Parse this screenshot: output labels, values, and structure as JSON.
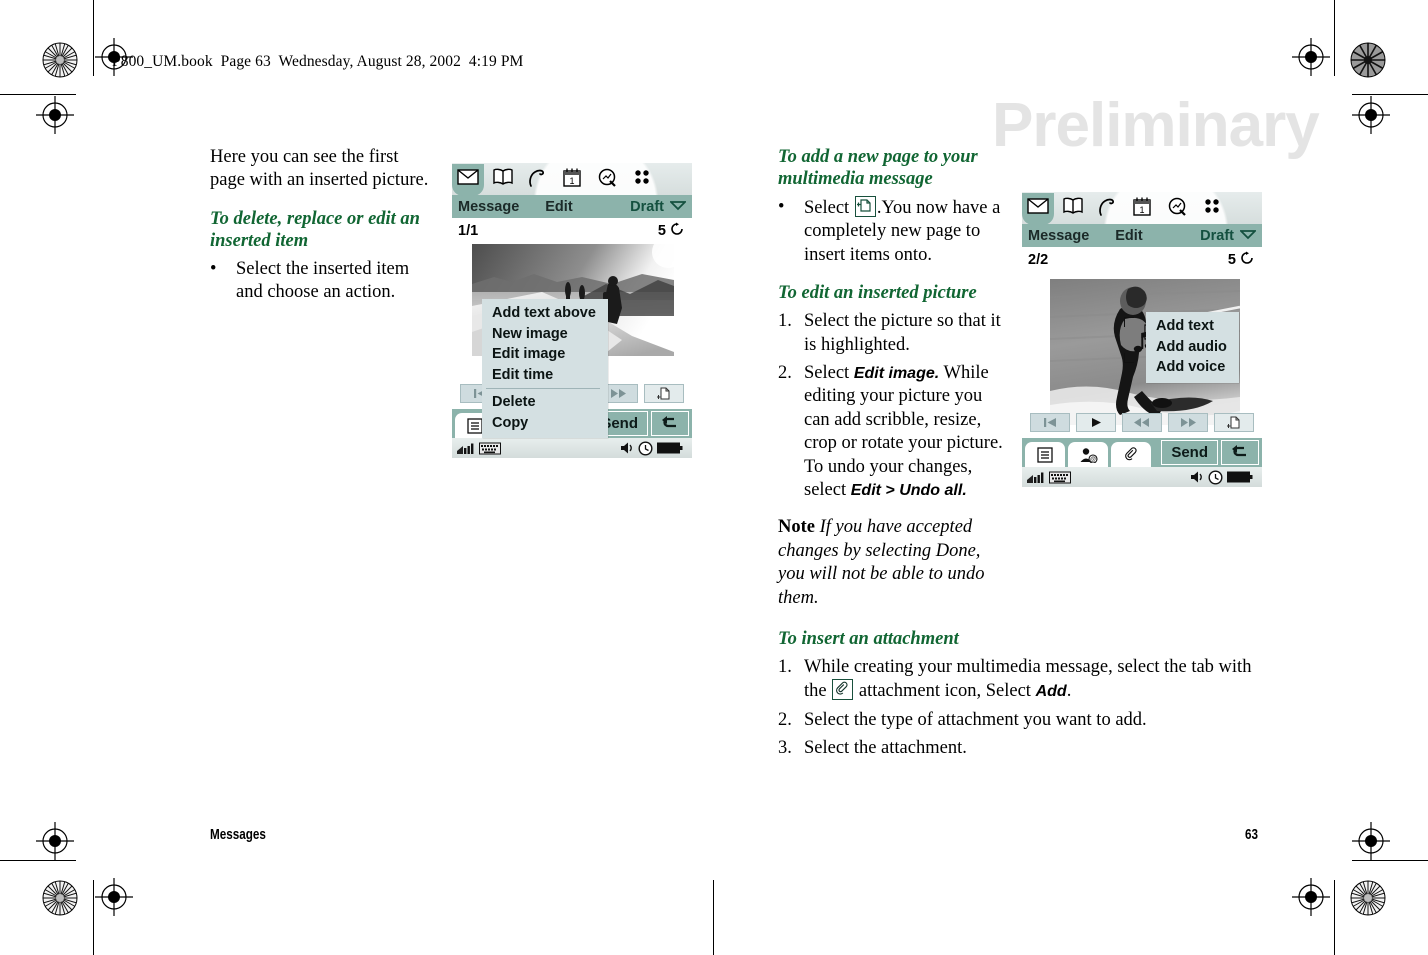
{
  "page": {
    "running_head": "P800_UM.book  Page 63  Wednesday, August 28, 2002  4:19 PM",
    "watermark": "Preliminary",
    "footer_left": "Messages",
    "footer_right": "63"
  },
  "left_column": {
    "intro": "Here you can see the first page with an inserted picture.",
    "heading": "To delete, replace or edit an inserted item",
    "bullet_mark": "•",
    "bullet_text": "Select the inserted item and choose an action."
  },
  "middle_column": {
    "heading_add_page": "To add a new page to your multimedia message",
    "bullet_mark": "•",
    "add_page_text_before": "Select",
    "add_page_text_after": ".You now have a completely new page to insert items onto.",
    "heading_edit_picture": "To edit an inserted picture",
    "steps_edit": [
      {
        "num": "1.",
        "text": "Select the picture so that it is highlighted."
      },
      {
        "num": "2.",
        "text_before": "Select ",
        "bold1": "Edit image.",
        "text_mid": " While editing your picture you can add scribble, resize, crop or rotate your picture. To undo your changes, select ",
        "bold2": "Edit > Undo all.",
        "text_after": ""
      }
    ],
    "note_lead": "Note",
    "note_body": " If you have accepted changes by selecting Done, you will not be able to undo them."
  },
  "wide_column": {
    "heading_attachment": "To insert an attachment",
    "steps": [
      {
        "num": "1.",
        "text_before": "While creating your multimedia message, select the tab with the ",
        "text_after": " attachment icon, Select ",
        "bold": "Add",
        "text_end": "."
      },
      {
        "num": "2.",
        "text": "Select the type of attachment you want to add."
      },
      {
        "num": "3.",
        "text": "Select the attachment."
      }
    ]
  },
  "phone_left": {
    "tabs": [
      {
        "icon": "envelope-icon",
        "active": true
      },
      {
        "icon": "book-icon",
        "active": false
      },
      {
        "icon": "phone-handset-icon",
        "active": false
      },
      {
        "icon": "calendar-icon",
        "active": false
      },
      {
        "icon": "magnifier-icon",
        "active": false
      },
      {
        "icon": "apps-grid-icon",
        "active": false
      }
    ],
    "menubar": {
      "message": "Message",
      "edit": "Edit",
      "draft": "Draft",
      "dropdown_icon": "chevron-down-icon"
    },
    "page_indicator": "1/1",
    "timer": "5",
    "timer_icon": "clock-reset-icon",
    "photo_alt": "mountain-hikers-photo",
    "popup_menu": {
      "items": [
        "Add text above",
        "New image",
        "Edit image",
        "Edit time"
      ],
      "items_after_separator": [
        "Delete",
        "Copy"
      ]
    },
    "transport_icons": [
      "skip-start-icon",
      "play-icon",
      "rewind-icon",
      "fast-forward-icon",
      "new-page-icon"
    ],
    "bottom_tabs": [
      "list-icon",
      "contact-at-icon",
      "paperclip-icon"
    ],
    "send_label": "Send",
    "back_icon": "back-arrow-icon",
    "status_icons": [
      "signal-bars-icon",
      "keyboard-icon",
      "speaker-icon",
      "clock-icon",
      "battery-icon"
    ]
  },
  "phone_right": {
    "tabs": [
      {
        "icon": "envelope-icon",
        "active": true
      },
      {
        "icon": "book-icon",
        "active": false
      },
      {
        "icon": "phone-handset-icon",
        "active": false
      },
      {
        "icon": "calendar-icon",
        "active": false
      },
      {
        "icon": "magnifier-icon",
        "active": false
      },
      {
        "icon": "apps-grid-icon",
        "active": false
      }
    ],
    "menubar": {
      "message": "Message",
      "edit": "Edit",
      "draft": "Draft",
      "dropdown_icon": "chevron-down-icon"
    },
    "page_indicator": "2/2",
    "timer": "5",
    "timer_icon": "clock-reset-icon",
    "photo_alt": "wakeboarder-photo",
    "placeholder_icon": "music-image-placeholder-icon",
    "popup_menu": {
      "items": [
        "Add text",
        "Add audio",
        "Add voice"
      ]
    },
    "transport_icons": [
      "skip-start-icon",
      "play-icon",
      "rewind-icon",
      "fast-forward-icon",
      "new-page-icon"
    ],
    "bottom_tabs": [
      "list-icon",
      "contact-at-icon",
      "paperclip-icon"
    ],
    "send_label": "Send",
    "back_icon": "back-arrow-icon",
    "status_icons": [
      "signal-bars-icon",
      "keyboard-icon",
      "speaker-icon",
      "clock-icon",
      "battery-icon"
    ]
  },
  "colors": {
    "heading_green": "#116633",
    "teal_bar": "#8cb3ab",
    "popup_bg": "#d4e0e2",
    "watermark_gray": "#e4e4e4"
  }
}
